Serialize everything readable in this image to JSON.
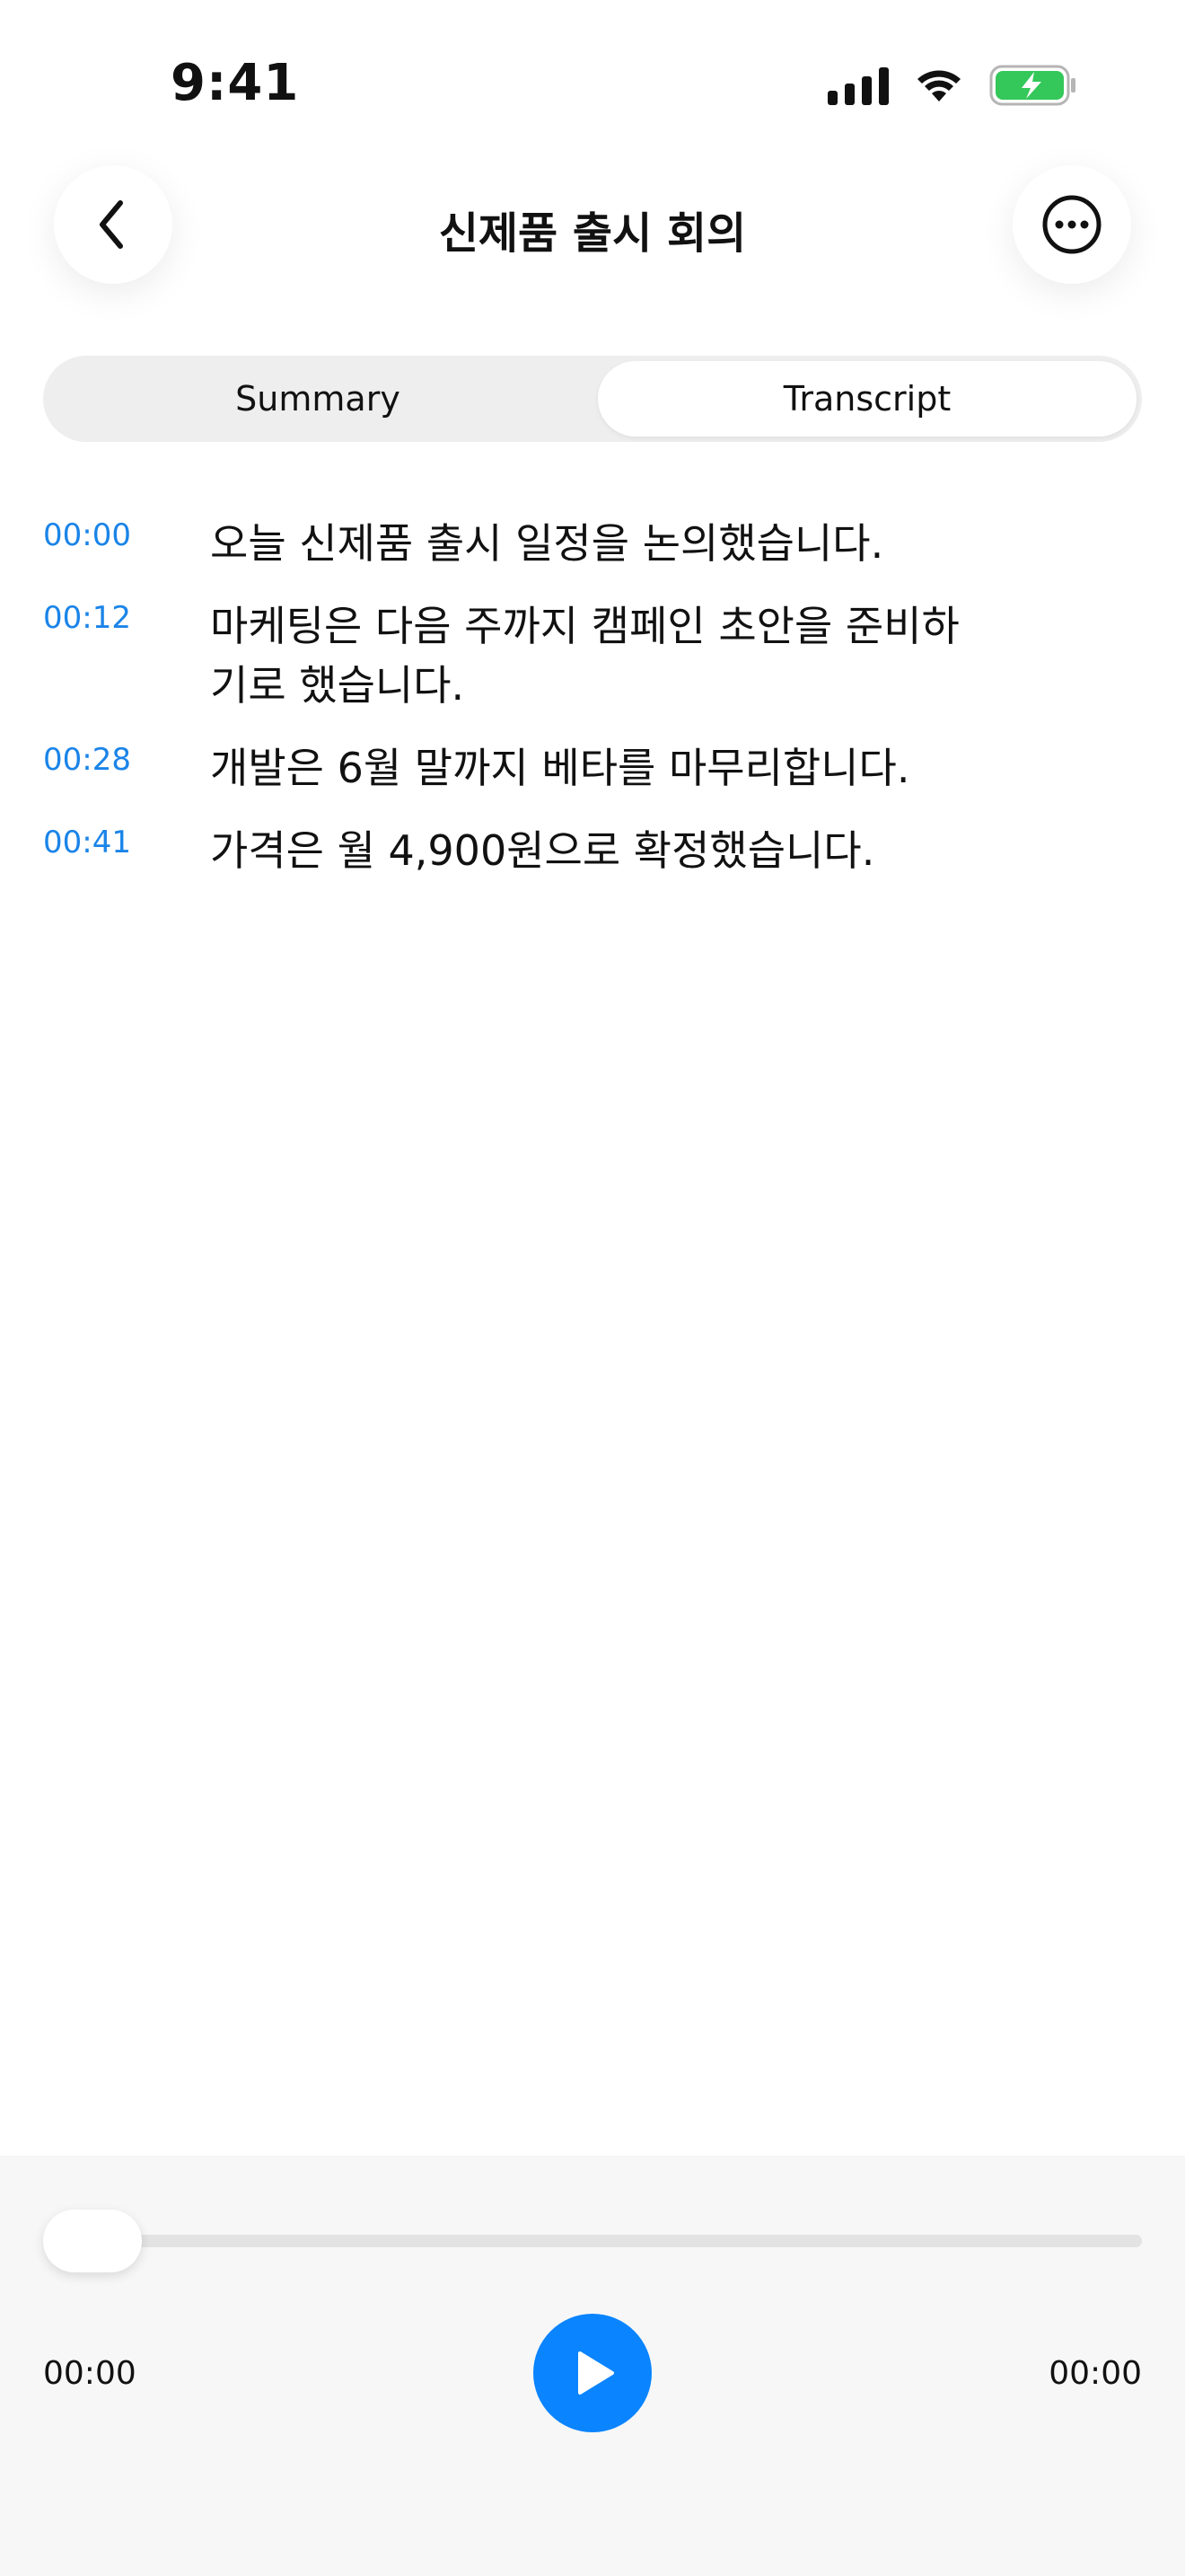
{
  "status_bar": {
    "time": "9:41",
    "icons": [
      "signal-icon",
      "wifi-icon",
      "battery-charging-icon"
    ],
    "battery_color": "#34c759"
  },
  "header": {
    "title": "신제품 출시 회의",
    "back_icon": "chevron-left-icon",
    "more_icon": "ellipsis-circle-icon"
  },
  "tabs": [
    {
      "label": "Summary",
      "selected": false
    },
    {
      "label": "Transcript",
      "selected": true
    }
  ],
  "transcript": [
    {
      "time": "00:00",
      "text": "오늘 신제품 출시 일정을 논의했습니다."
    },
    {
      "time": "00:12",
      "text": "마케팅은 다음 주까지 캠페인 초안을 준비하기로 했습니다."
    },
    {
      "time": "00:28",
      "text": "개발은 6월 말까지 베타를 마무리합니다."
    },
    {
      "time": "00:41",
      "text": "가격은 월 4,900원으로 확정했습니다."
    }
  ],
  "player": {
    "current_time": "00:00",
    "duration": "00:00",
    "progress": 0,
    "play_icon": "play-icon"
  },
  "colors": {
    "accent": "#0a84ff",
    "timestamp": "#1a84e8"
  }
}
